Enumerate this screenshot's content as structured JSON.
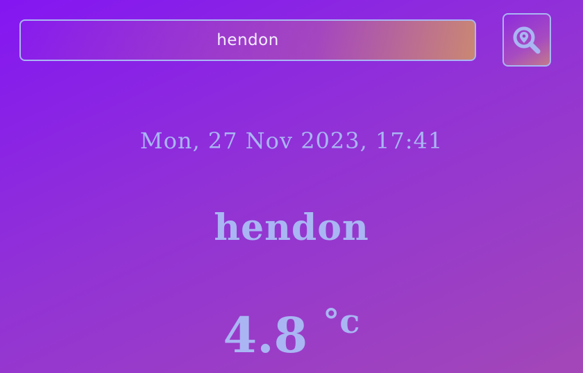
{
  "search": {
    "value": "hendon"
  },
  "search_button": {
    "icon": "map-search-icon"
  },
  "weather": {
    "datetime": "Mon, 27 Nov 2023, 17:41",
    "city": "hendon",
    "temperature": "4.8",
    "unit": "°c"
  },
  "colors": {
    "text": "#a9b6f3",
    "background_start": "#8416f2",
    "background_end": "#a347b8"
  }
}
